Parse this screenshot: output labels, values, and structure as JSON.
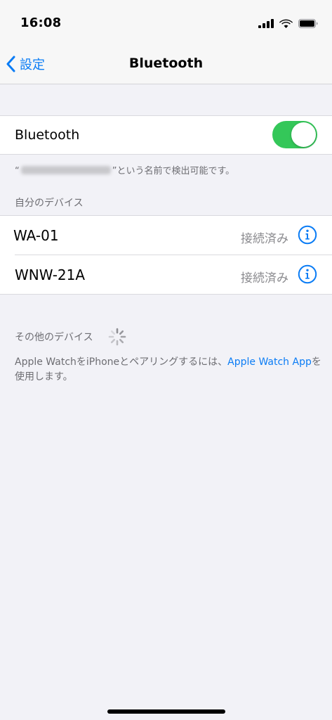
{
  "status_bar": {
    "time": "16:08",
    "icons": [
      "cellular-signal-icon",
      "wifi-icon",
      "battery-icon"
    ]
  },
  "nav": {
    "back_label": "設定",
    "title": "Bluetooth"
  },
  "bluetooth": {
    "label": "Bluetooth",
    "enabled": true,
    "toggle_color": "#34c759"
  },
  "discoverable_note": {
    "open_quote": "“",
    "suffix": "”という名前で検出可能です。"
  },
  "my_devices": {
    "header": "自分のデバイス",
    "devices": [
      {
        "name": "WA-01",
        "status": "接続済み"
      },
      {
        "name": "WNW-21A",
        "status": "接続済み"
      }
    ]
  },
  "other_devices": {
    "header": "その他のデバイス"
  },
  "pairing_note": {
    "text_before": "Apple WatchをiPhoneとペアリングするには、",
    "link": "Apple Watch App",
    "text_after": "を使用します。"
  },
  "colors": {
    "accent": "#0a7cf5",
    "background": "#f2f2f7",
    "secondary_text": "#6d6d72"
  }
}
